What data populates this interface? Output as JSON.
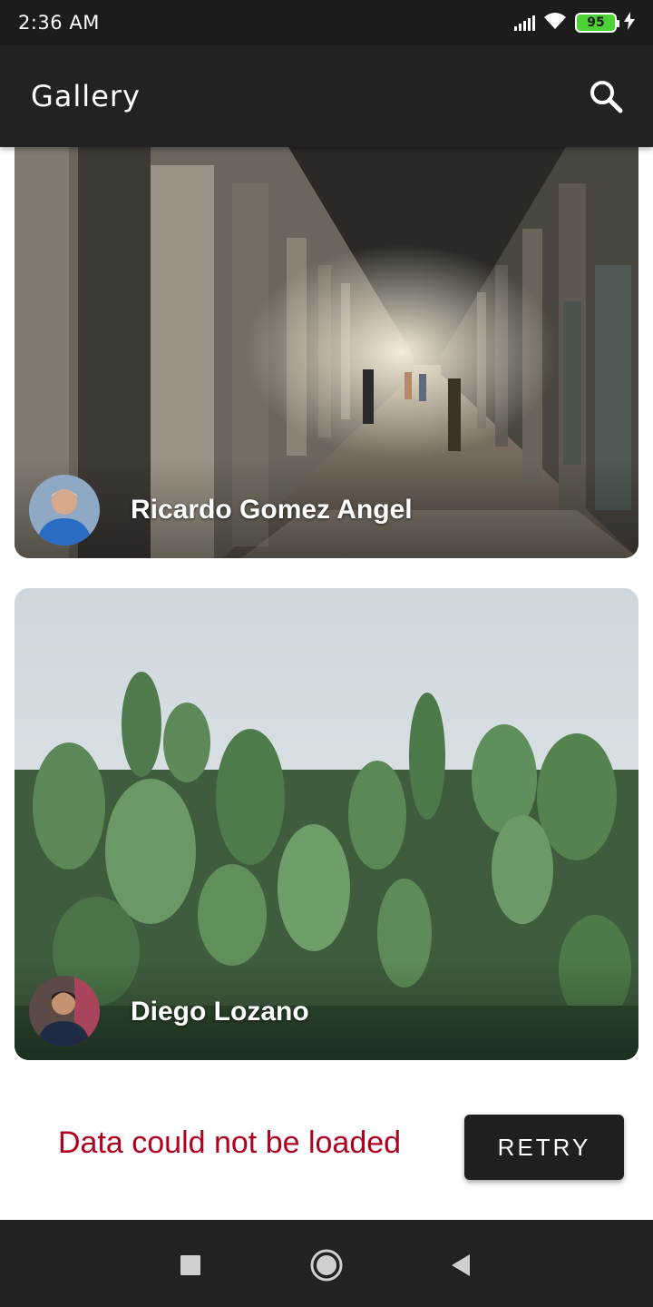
{
  "status_bar": {
    "time": "2:36 AM",
    "battery": "95",
    "icons": [
      "signal-icon",
      "wifi-icon",
      "battery-icon",
      "charging-icon"
    ]
  },
  "app_bar": {
    "title": "Gallery",
    "search_icon": "search-icon"
  },
  "cards": [
    {
      "author": "Ricardo Gomez Angel",
      "photo": "colonnade-corridor"
    },
    {
      "author": "Diego Lozano",
      "photo": "cactus-field"
    }
  ],
  "error": {
    "message": "Data could not be loaded",
    "retry_label": "RETRY",
    "color": "#b00020"
  },
  "nav_bar": {
    "icons": [
      "recents-icon",
      "home-icon",
      "back-icon"
    ]
  }
}
